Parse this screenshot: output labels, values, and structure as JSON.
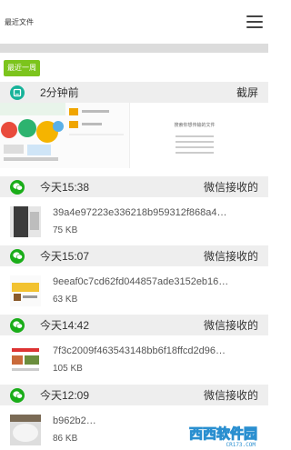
{
  "header": {
    "title": "最近文件"
  },
  "filter": {
    "label": "最近一周"
  },
  "sections": [
    {
      "time": "2分钟前",
      "source": "截屏",
      "icon": "screenshot-icon",
      "screenshot_text": [
        "搜索你想传输的文件"
      ]
    },
    {
      "time": "今天15:38",
      "source": "微信接收的",
      "icon": "wechat-icon",
      "file": {
        "name": "39a4e97223e336218b959312f868a4…",
        "size": "75 KB"
      }
    },
    {
      "time": "今天15:07",
      "source": "微信接收的",
      "icon": "wechat-icon",
      "file": {
        "name": "9eeaf0c7cd62fd044857ade3152eb16…",
        "size": "63 KB"
      }
    },
    {
      "time": "今天14:42",
      "source": "微信接收的",
      "icon": "wechat-icon",
      "file": {
        "name": "7f3c2009f463543148bb6f18ffcd2d96…",
        "size": "105 KB"
      }
    },
    {
      "time": "今天12:09",
      "source": "微信接收的",
      "icon": "wechat-icon",
      "file": {
        "name": "b962b2…",
        "size": "86 KB"
      }
    }
  ],
  "watermark": {
    "text": "西西软件园",
    "sub": "CR173.COM"
  },
  "colors": {
    "accent_green": "#7cc41c",
    "wechat_green": "#1aad19",
    "screenshot_teal": "#17b39a",
    "header_bg": "#eeeeee"
  }
}
